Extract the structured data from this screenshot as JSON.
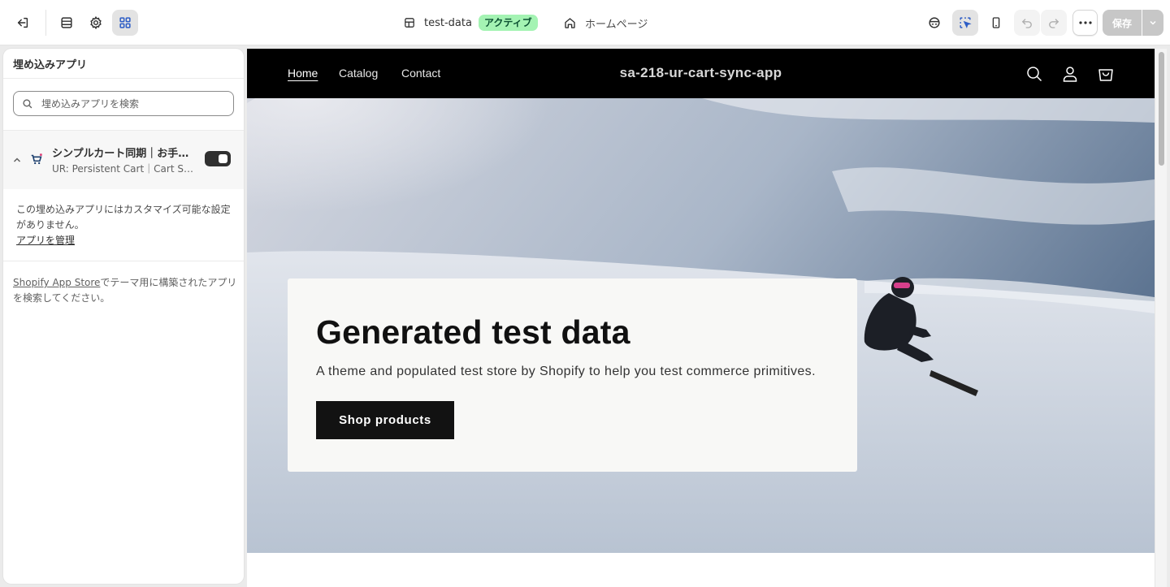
{
  "topbar": {
    "theme_name": "test-data",
    "theme_status": "アクティブ",
    "page_name": "ホームページ",
    "save_label": "保存"
  },
  "sidebar": {
    "title": "埋め込みアプリ",
    "search_placeholder": "埋め込みアプリを検索",
    "app": {
      "name": "シンプルカート同期｜お手軽にカート同期",
      "subtitle": "UR: Persistent Cart｜Cart Sync",
      "enabled": true
    },
    "no_settings_text": "この埋め込みアプリにはカスタマイズ可能な設定がありません。",
    "manage_link": "アプリを管理",
    "store_link": "Shopify App Store",
    "store_text": "でテーマ用に構築されたアプリを検索してください。"
  },
  "preview": {
    "nav": [
      "Home",
      "Catalog",
      "Contact"
    ],
    "store_name": "sa-218-ur-cart-sync-app",
    "hero_title": "Generated test data",
    "hero_text": "A theme and populated test store by Shopify to help you test commerce primitives.",
    "hero_button": "Shop products"
  },
  "colors": {
    "badge_bg": "#a4f3b3",
    "header_bg": "#000000",
    "button_bg": "#121212"
  }
}
